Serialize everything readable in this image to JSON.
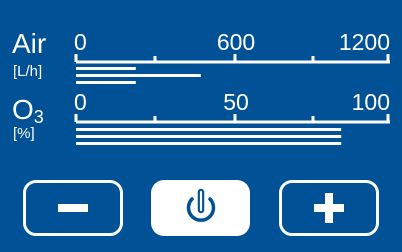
{
  "colors": {
    "background": "#005195",
    "foreground": "#ffffff",
    "accent_icon": "#005195"
  },
  "air": {
    "label": "Air",
    "unit": "[L/h]",
    "ticks": [
      "0",
      "600",
      "1200"
    ],
    "range": [
      0,
      1200
    ],
    "values": [
      230,
      480,
      230
    ]
  },
  "o3": {
    "label": "O",
    "label_sub": "3",
    "unit": "[%]",
    "ticks": [
      "0",
      "50",
      "100"
    ],
    "range": [
      0,
      100
    ],
    "values": [
      85,
      85,
      85
    ]
  },
  "controls": {
    "decrease_icon": "minus-icon",
    "power_icon": "power-icon",
    "increase_icon": "plus-icon"
  }
}
